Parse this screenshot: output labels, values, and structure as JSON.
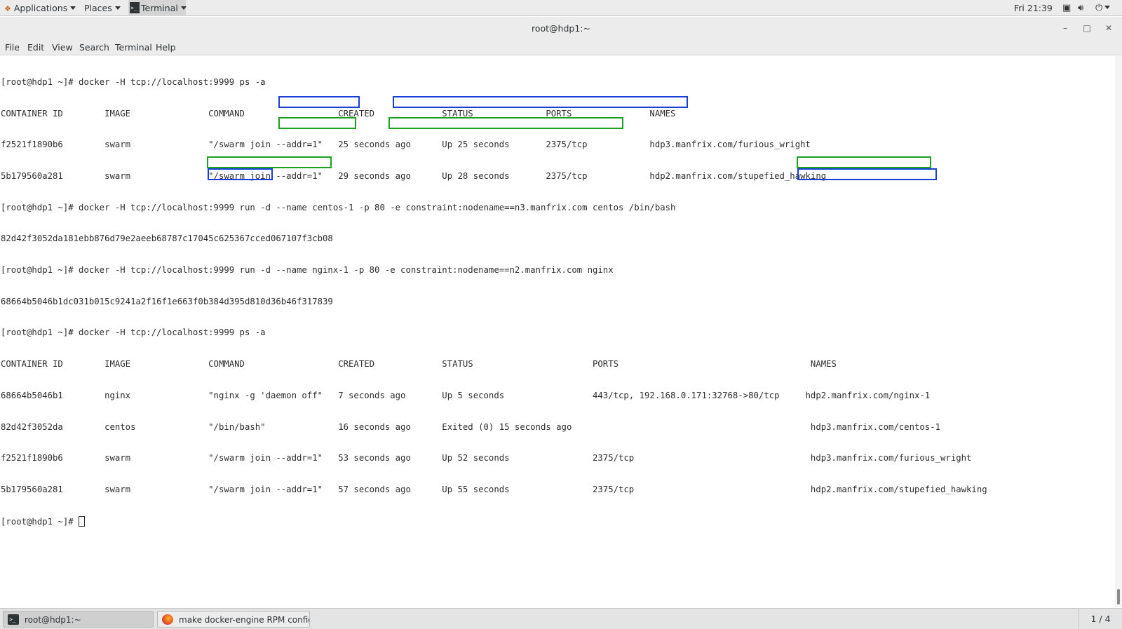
{
  "top_panel": {
    "applications_label": "Applications",
    "places_label": "Places",
    "terminal_label": "Terminal",
    "clock": "Fri 21:39"
  },
  "window": {
    "title": "root@hdp1:~",
    "minimize_glyph": "–",
    "maximize_glyph": "□",
    "close_glyph": "✕"
  },
  "menubar": {
    "items": [
      "File",
      "Edit",
      "View",
      "Search",
      "Terminal",
      "Help"
    ]
  },
  "terminal": {
    "lines": [
      "[root@hdp1 ~]# docker -H tcp://localhost:9999 ps -a",
      "CONTAINER ID        IMAGE               COMMAND                  CREATED             STATUS              PORTS               NAMES",
      "f2521f1890b6        swarm               \"/swarm join --addr=1\"   25 seconds ago      Up 25 seconds       2375/tcp            hdp3.manfrix.com/furious_wright",
      "5b179560a281        swarm               \"/swarm join --addr=1\"   29 seconds ago      Up 28 seconds       2375/tcp            hdp2.manfrix.com/stupefied_hawking",
      "[root@hdp1 ~]# docker -H tcp://localhost:9999 run -d --name centos-1 -p 80 -e constraint:nodename==n3.manfrix.com centos /bin/bash",
      "82d42f3052da181ebb876d79e2aeeb68787c17045c625367cced067107f3cb08",
      "[root@hdp1 ~]# docker -H tcp://localhost:9999 run -d --name nginx-1 -p 80 -e constraint:nodename==n2.manfrix.com nginx",
      "68664b5046b1dc031b015c9241a2f16f1e663f0b384d395d810d36b46f317839",
      "[root@hdp1 ~]# docker -H tcp://localhost:9999 ps -a",
      "CONTAINER ID        IMAGE               COMMAND                  CREATED             STATUS                       PORTS                                     NAMES",
      "68664b5046b1        nginx               \"nginx -g 'daemon off\"   7 seconds ago       Up 5 seconds                 443/tcp, 192.168.0.171:32768->80/tcp     hdp2.manfrix.com/nginx-1",
      "82d42f3052da        centos              \"/bin/bash\"              16 seconds ago      Exited (0) 15 seconds ago                                              hdp3.manfrix.com/centos-1",
      "f2521f1890b6        swarm               \"/swarm join --addr=1\"   53 seconds ago      Up 52 seconds                2375/tcp                                  hdp3.manfrix.com/furious_wright",
      "5b179560a281        swarm               \"/swarm join --addr=1\"   57 seconds ago      Up 55 seconds                2375/tcp                                  hdp2.manfrix.com/stupefied_hawking"
    ],
    "prompt": "[root@hdp1 ~]# "
  },
  "taskbar": {
    "tasks": [
      "root@hdp1:~",
      "make docker-engine RPM configur..."
    ],
    "workspace": "1 / 4"
  },
  "colors": {
    "highlight_blue": "#1840d8",
    "highlight_green": "#1aa31f"
  }
}
